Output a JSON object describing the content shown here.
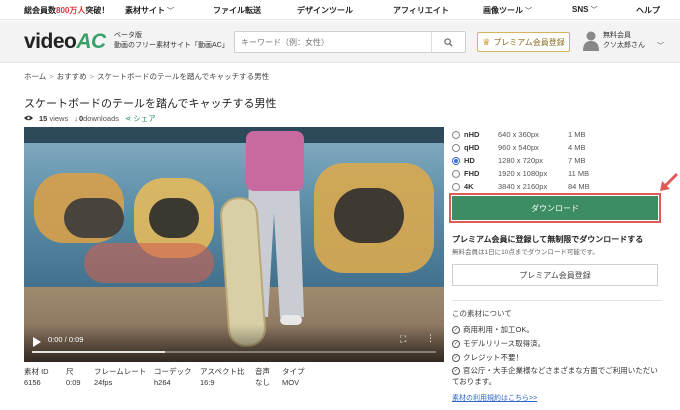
{
  "topnav": {
    "promo_prefix": "総会員数",
    "promo_highlight": "800万人",
    "promo_suffix": "突破！",
    "items": [
      {
        "label": "素材サイト",
        "chevron": true
      },
      {
        "label": "ファイル転送",
        "chevron": false
      },
      {
        "label": "デザインツール",
        "chevron": false
      },
      {
        "label": "アフィリエイト",
        "chevron": false
      },
      {
        "label": "画像ツール",
        "chevron": true
      },
      {
        "label": "SNS",
        "chevron": true
      },
      {
        "label": "ヘルプ",
        "chevron": false
      }
    ]
  },
  "header": {
    "logo_text": "video",
    "logo_accent": "AC",
    "tagline_line1": "ベータ版",
    "tagline_line2": "動画のフリー素材サイト「動画AC」",
    "search_placeholder": "キーワード（例：女性）",
    "premium_label": "プレミアム会員登録",
    "user_line1": "無料会員",
    "user_line2": "クソ太郎さん"
  },
  "breadcrumb": [
    "ホーム",
    "おすすめ",
    "スケートボードのテールを踏んでキャッチする男性"
  ],
  "video": {
    "title": "スケートボードのテールを踏んでキャッチする男性",
    "views_count": "15",
    "views_label": "views",
    "downloads_count": "0",
    "downloads_label": "downloads",
    "share_label": "シェア",
    "time_display": "0:00 / 0:09",
    "progress": 0.33
  },
  "spec": {
    "headers": [
      "素材 ID",
      "尺",
      "フレームレート",
      "コーデック",
      "アスペクト比",
      "音声",
      "タイプ"
    ],
    "values": [
      "6156",
      "0:09",
      "24fps",
      "h264",
      "16:9",
      "なし",
      "MOV"
    ]
  },
  "sizes": [
    {
      "name": "nHD",
      "dims": "640 x 360px",
      "size": "1 MB",
      "selected": false
    },
    {
      "name": "qHD",
      "dims": "960 x 540px",
      "size": "4 MB",
      "selected": false
    },
    {
      "name": "HD",
      "dims": "1280 x 720px",
      "size": "7 MB",
      "selected": true
    },
    {
      "name": "FHD",
      "dims": "1920 x 1080px",
      "size": "11 MB",
      "selected": false
    },
    {
      "name": "4K",
      "dims": "3840 x 2160px",
      "size": "84 MB",
      "selected": false
    }
  ],
  "download_label": "ダウンロード",
  "premium_promo": {
    "heading": "プレミアム会員に登録して無制限でダウンロードする",
    "sub": "無料会員は1日に10点までダウンロード可能です。",
    "button": "プレミアム会員登録"
  },
  "about": {
    "title": "この素材について",
    "features": [
      "商用利用・加工OK。",
      "モデルリリース取得済。",
      "クレジット不要！",
      "官公庁・大手企業様などさまざまな方面でご利用いただいております。"
    ],
    "license_link": "素材の利用規約はこちら>>"
  },
  "colors": {
    "accent_green": "#3c8c64",
    "highlight_red": "#e05a5a",
    "link_blue": "#2f66c9",
    "promo_red": "#e3342f"
  }
}
